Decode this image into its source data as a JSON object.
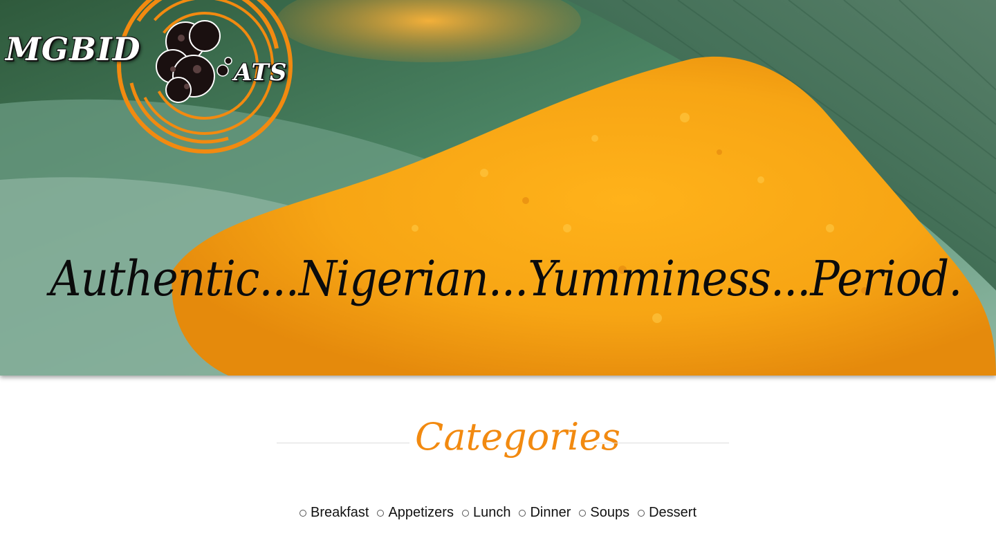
{
  "logo": {
    "main_text": "MGBID",
    "tail_text": "ATS"
  },
  "hero": {
    "tagline": "Authentic...Nigerian...Yumminess...Period."
  },
  "categories_section": {
    "heading": "Categories",
    "items": [
      {
        "label": "Breakfast",
        "selected": false
      },
      {
        "label": "Appetizers",
        "selected": false
      },
      {
        "label": "Lunch",
        "selected": false
      },
      {
        "label": "Dinner",
        "selected": false
      },
      {
        "label": "Soups",
        "selected": false
      },
      {
        "label": "Dessert",
        "selected": false
      }
    ]
  },
  "colors": {
    "accent": "#f28a10",
    "text": "#111111",
    "rule": "#dddddd"
  }
}
